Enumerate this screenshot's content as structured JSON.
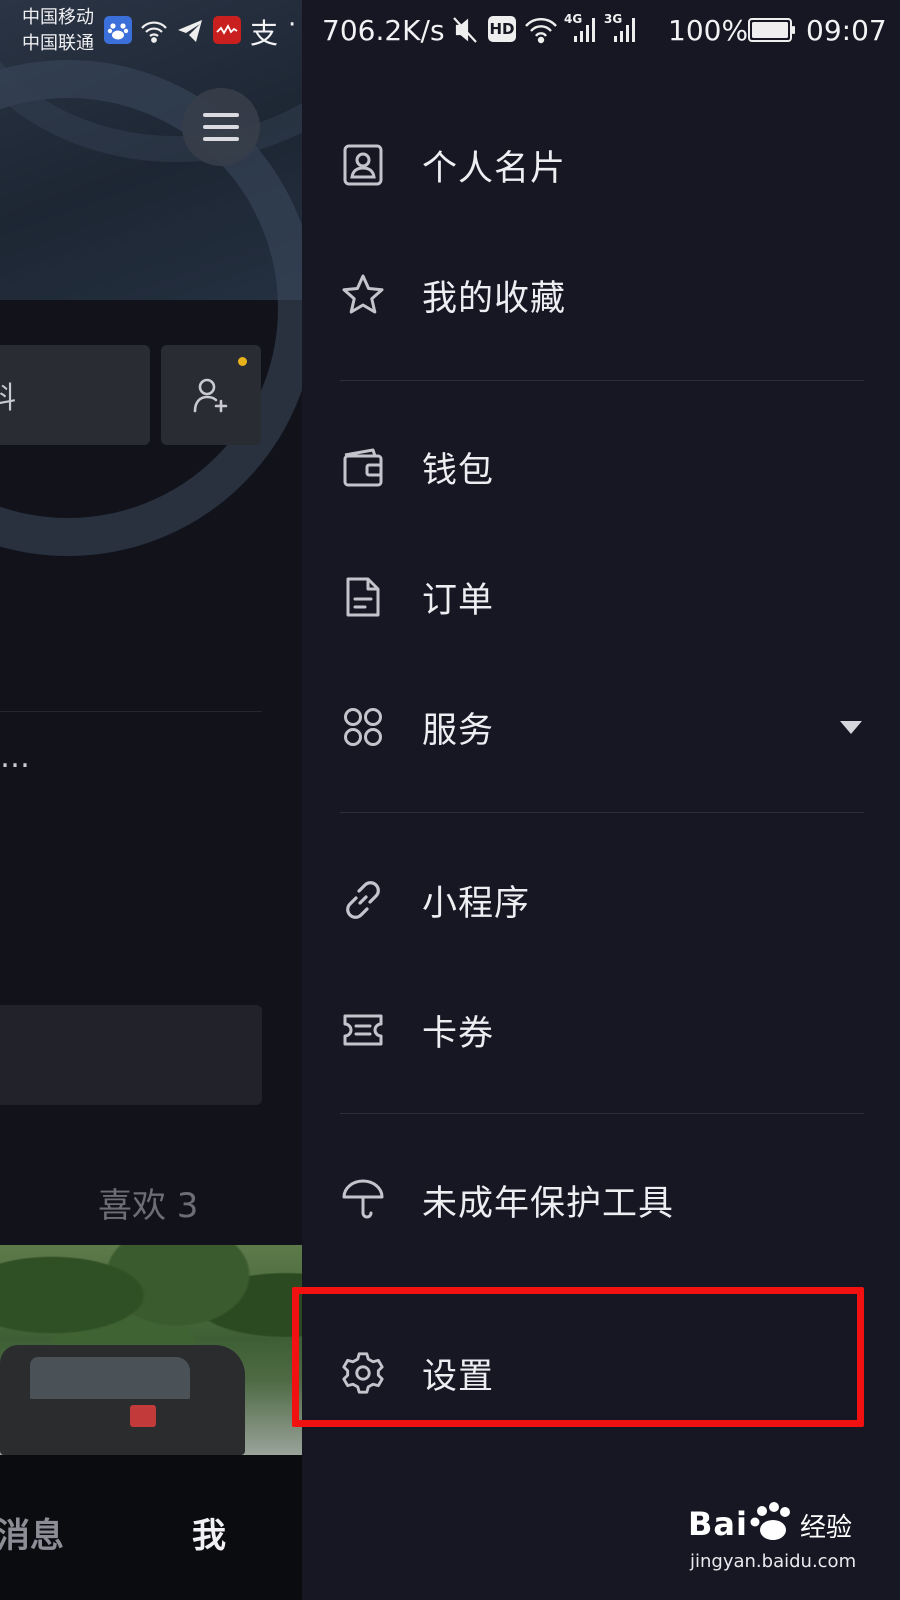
{
  "status_bar": {
    "carrier_1": "中国移动",
    "carrier_2": "中国联通",
    "net_speed": "706.2K/s",
    "battery": "100%",
    "time": "09:07",
    "icons": [
      "baidu-app-icon",
      "wifi-hotspot-icon",
      "telegram-icon",
      "news-app-icon",
      "alipay-icon",
      "more-dots-icon",
      "mute-icon",
      "hd-icon",
      "wifi-icon",
      "signal-4g-icon",
      "signal-3g-icon",
      "battery-icon"
    ],
    "network_labels": {
      "lte": "4G",
      "three_g": "3G",
      "hd": "HD"
    }
  },
  "background_page": {
    "edit_profile_partial": "料",
    "bio_partial": "…",
    "tab_likes": "喜欢 3",
    "tab_messages_partial": "消息",
    "tab_me": "我"
  },
  "drawer": {
    "items": [
      {
        "icon": "business-card-icon",
        "label": "个人名片"
      },
      {
        "icon": "star-icon",
        "label": "我的收藏"
      },
      {
        "icon": "wallet-icon",
        "label": "钱包"
      },
      {
        "icon": "document-icon",
        "label": "订单"
      },
      {
        "icon": "grid-icon",
        "label": "服务",
        "expandable": true
      },
      {
        "icon": "link-icon",
        "label": "小程序"
      },
      {
        "icon": "ticket-icon",
        "label": "卡券"
      },
      {
        "icon": "umbrella-icon",
        "label": "未成年保护工具"
      },
      {
        "icon": "gear-icon",
        "label": "设置",
        "highlighted": true
      }
    ]
  },
  "watermark": {
    "brand": "Bai",
    "brand_cn": "经验",
    "url": "jingyan.baidu.com"
  },
  "colors": {
    "drawer_bg": "#161722",
    "highlight": "#f21111",
    "notification_dot": "#e8b21a"
  }
}
